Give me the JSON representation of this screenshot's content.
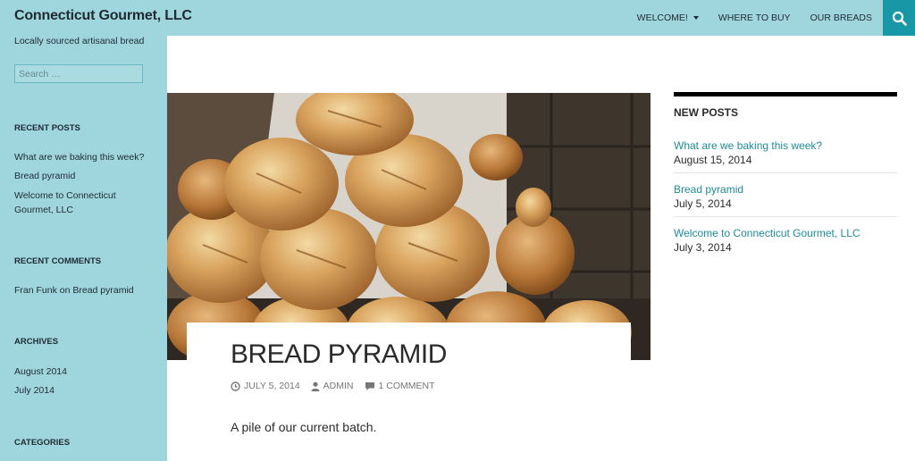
{
  "header": {
    "site_title": "Connecticut Gourmet, LLC",
    "nav": [
      {
        "label": "WELCOME!",
        "has_dropdown": true
      },
      {
        "label": "WHERE TO BUY",
        "has_dropdown": false
      },
      {
        "label": "OUR BREADS",
        "has_dropdown": false
      }
    ],
    "search_icon": "search-icon"
  },
  "sidebar": {
    "tagline": "Locally sourced artisanal bread",
    "search_placeholder": "Search …",
    "recent_posts": {
      "title": "RECENT POSTS",
      "items": [
        "What are we baking this week?",
        "Bread pyramid",
        "Welcome to Connecticut Gourmet, LLC"
      ]
    },
    "recent_comments": {
      "title": "RECENT COMMENTS",
      "items": [
        "Fran Funk on Bread pyramid"
      ]
    },
    "archives": {
      "title": "ARCHIVES",
      "items": [
        "August 2014",
        "July 2014"
      ]
    },
    "categories": {
      "title": "CATEGORIES"
    }
  },
  "post": {
    "title": "BREAD PYRAMID",
    "date": "JULY 5, 2014",
    "author": "ADMIN",
    "comments": "1 COMMENT",
    "excerpt": "A pile of our current batch."
  },
  "new_posts": {
    "title": "NEW POSTS",
    "items": [
      {
        "title": "What are we baking this week?",
        "date": "August 15, 2014"
      },
      {
        "title": "Bread pyramid",
        "date": "July 5, 2014"
      },
      {
        "title": "Welcome to Connecticut Gourmet, LLC",
        "date": "July 3, 2014"
      }
    ]
  },
  "colors": {
    "header_bg": "#9fd6dd",
    "search_bg": "#1897a6",
    "link_green": "#24890d"
  }
}
